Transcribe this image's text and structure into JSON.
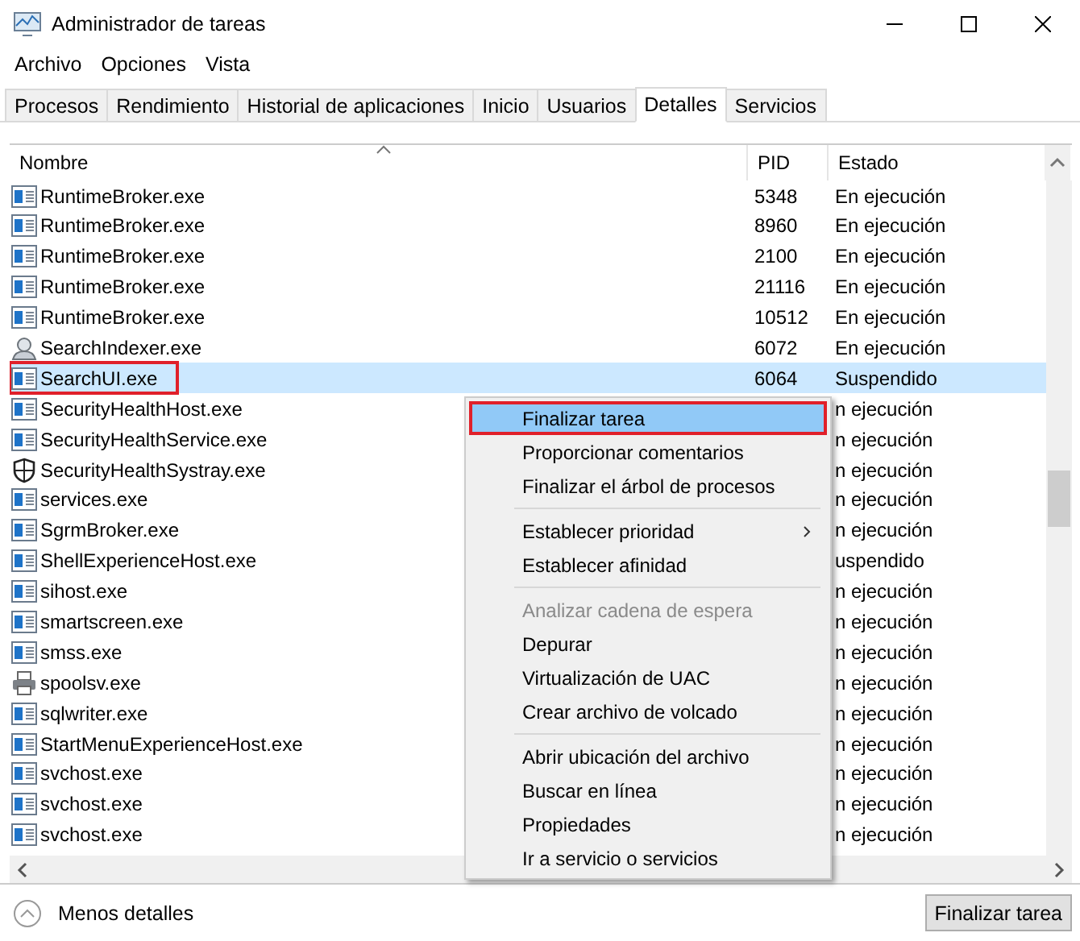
{
  "window": {
    "title": "Administrador de tareas"
  },
  "menu_bar": [
    "Archivo",
    "Opciones",
    "Vista"
  ],
  "tabs": [
    {
      "label": "Procesos",
      "selected": false
    },
    {
      "label": "Rendimiento",
      "selected": false
    },
    {
      "label": "Historial de aplicaciones",
      "selected": false
    },
    {
      "label": "Inicio",
      "selected": false
    },
    {
      "label": "Usuarios",
      "selected": false
    },
    {
      "label": "Detalles",
      "selected": true
    },
    {
      "label": "Servicios",
      "selected": false
    }
  ],
  "table": {
    "columns": [
      "Nombre",
      "PID",
      "Estado"
    ],
    "rows": [
      {
        "kind": "app",
        "name": "RuntimeBroker.exe",
        "pid": "5348",
        "status": "En ejecución",
        "selected": false,
        "outlined": false
      },
      {
        "kind": "app",
        "name": "RuntimeBroker.exe",
        "pid": "8960",
        "status": "En ejecución",
        "selected": false,
        "outlined": false
      },
      {
        "kind": "app",
        "name": "RuntimeBroker.exe",
        "pid": "2100",
        "status": "En ejecución",
        "selected": false,
        "outlined": false
      },
      {
        "kind": "app",
        "name": "RuntimeBroker.exe",
        "pid": "21116",
        "status": "En ejecución",
        "selected": false,
        "outlined": false
      },
      {
        "kind": "app",
        "name": "RuntimeBroker.exe",
        "pid": "10512",
        "status": "En ejecución",
        "selected": false,
        "outlined": false
      },
      {
        "kind": "indexer",
        "name": "SearchIndexer.exe",
        "pid": "6072",
        "status": "En ejecución",
        "selected": false,
        "outlined": false
      },
      {
        "kind": "app",
        "name": "SearchUI.exe",
        "pid": "6064",
        "status": "Suspendido",
        "selected": true,
        "outlined": true
      },
      {
        "kind": "app",
        "name": "SecurityHealthHost.exe",
        "status": "n ejecución",
        "selected": false,
        "outlined": false
      },
      {
        "kind": "app",
        "name": "SecurityHealthService.exe",
        "status": "n ejecución",
        "selected": false,
        "outlined": false
      },
      {
        "kind": "shield",
        "name": "SecurityHealthSystray.exe",
        "status": "n ejecución",
        "selected": false,
        "outlined": false
      },
      {
        "kind": "app",
        "name": "services.exe",
        "status": "n ejecución",
        "selected": false,
        "outlined": false
      },
      {
        "kind": "app",
        "name": "SgrmBroker.exe",
        "status": "n ejecución",
        "selected": false,
        "outlined": false
      },
      {
        "kind": "app",
        "name": "ShellExperienceHost.exe",
        "status": "uspendido",
        "selected": false,
        "outlined": false
      },
      {
        "kind": "app",
        "name": "sihost.exe",
        "status": "n ejecución",
        "selected": false,
        "outlined": false
      },
      {
        "kind": "app",
        "name": "smartscreen.exe",
        "status": "n ejecución",
        "selected": false,
        "outlined": false
      },
      {
        "kind": "app",
        "name": "smss.exe",
        "status": "n ejecución",
        "selected": false,
        "outlined": false
      },
      {
        "kind": "printer",
        "name": "spoolsv.exe",
        "status": "n ejecución",
        "selected": false,
        "outlined": false
      },
      {
        "kind": "app",
        "name": "sqlwriter.exe",
        "status": "n ejecución",
        "selected": false,
        "outlined": false
      },
      {
        "kind": "app",
        "name": "StartMenuExperienceHost.exe",
        "status": "n ejecución",
        "selected": false,
        "outlined": false
      },
      {
        "kind": "app",
        "name": "svchost.exe",
        "status": "n ejecución",
        "selected": false,
        "outlined": false
      },
      {
        "kind": "app",
        "name": "svchost.exe",
        "status": "n ejecución",
        "selected": false,
        "outlined": false
      },
      {
        "kind": "app",
        "name": "svchost.exe",
        "status": "n ejecución",
        "selected": false,
        "outlined": false
      }
    ]
  },
  "context_menu": [
    {
      "kind": "item",
      "label": "Finalizar tarea",
      "selected": true,
      "outlined": true,
      "disabled": false
    },
    {
      "kind": "item",
      "label": "Proporcionar comentarios",
      "selected": false,
      "outlined": false,
      "disabled": false
    },
    {
      "kind": "item",
      "label": "Finalizar el árbol de procesos",
      "selected": false,
      "outlined": false,
      "disabled": false
    },
    {
      "kind": "separator"
    },
    {
      "kind": "submenu",
      "label": "Establecer prioridad",
      "selected": false,
      "outlined": false,
      "disabled": false
    },
    {
      "kind": "item",
      "label": "Establecer afinidad",
      "selected": false,
      "outlined": false,
      "disabled": false
    },
    {
      "kind": "separator"
    },
    {
      "kind": "item",
      "label": "Analizar cadena de espera",
      "selected": false,
      "outlined": false,
      "disabled": true
    },
    {
      "kind": "item",
      "label": "Depurar",
      "selected": false,
      "outlined": false,
      "disabled": false
    },
    {
      "kind": "item",
      "label": "Virtualización de UAC",
      "selected": false,
      "outlined": false,
      "disabled": false
    },
    {
      "kind": "item",
      "label": "Crear archivo de volcado",
      "selected": false,
      "outlined": false,
      "disabled": false
    },
    {
      "kind": "separator"
    },
    {
      "kind": "item",
      "label": "Abrir ubicación del archivo",
      "selected": false,
      "outlined": false,
      "disabled": false
    },
    {
      "kind": "item",
      "label": "Buscar en línea",
      "selected": false,
      "outlined": false,
      "disabled": false
    },
    {
      "kind": "item",
      "label": "Propiedades",
      "selected": false,
      "outlined": false,
      "disabled": false
    },
    {
      "kind": "item",
      "label": "Ir a servicio o servicios",
      "selected": false,
      "outlined": false,
      "disabled": false
    }
  ],
  "footer": {
    "toggle": "Menos detalles",
    "button": "Finalizar tarea"
  }
}
